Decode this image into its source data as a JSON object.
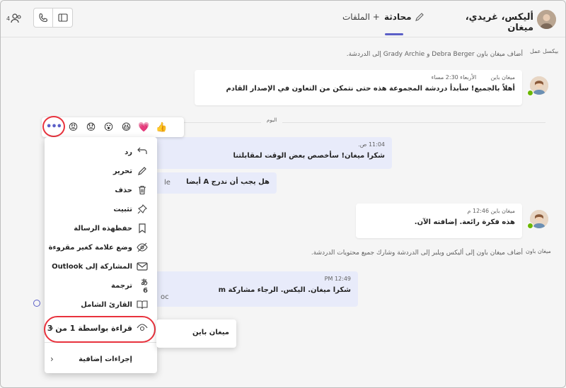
{
  "header": {
    "chat_title": "أليكس، غريدي، ميغان",
    "people_count": "4",
    "tabs": [
      {
        "label": "الملفات +"
      },
      {
        "label": "محادثة"
      }
    ]
  },
  "system_messages": [
    {
      "icon": "ﺑﻴﻜﺴﻞ ﻋﻤﻞ",
      "text": "أضاف ميغان باون Debra Berger و Grady Archie إلى الدردشة."
    },
    {
      "icon": "ﻣﻴﻐﺎﻥ ﺑﺎﻭﻥ",
      "text": "أضاف ميغان باون إلى أليكس ويلبر إلى الدردشة وشارك جميع محتويات الدردشة."
    }
  ],
  "day_divider": "اليوم",
  "messages": [
    {
      "sender": "ميغان باين",
      "time": "الأربعاء 2:30 مساء",
      "text": "أهلاً بالجميع! سأبدأ دردشة المجموعة هذه حتى نتمكن من التعاون في الإصدار القادم"
    },
    {
      "time": "11:04 ص.",
      "text": "شكرا ميغان! سأخصص بعض الوقت لمقابلتنا"
    },
    {
      "partial_left": "le",
      "text": "هل يجب أن ندرج A أيضا"
    },
    {
      "sender": "ميغان باين",
      "time": "12:46 م",
      "text": "هذه فكرة رائعة. إضافته الآن."
    },
    {
      "time": "12:49 PM",
      "partial_left": "oc",
      "text": "شكرا ميغان. اليكس. الرجاء مشاركة m"
    }
  ],
  "reactions": [
    "👍",
    "💗",
    "😆",
    "😮",
    "😟",
    "😡"
  ],
  "more_options_label": "•••",
  "menu": {
    "items": [
      {
        "label": "رد",
        "icon": "reply-icon"
      },
      {
        "label": "تحرير",
        "icon": "edit-icon"
      },
      {
        "label": "حذف",
        "icon": "delete-icon"
      },
      {
        "label": "تثبيت",
        "icon": "pin-icon"
      },
      {
        "label": "حفظهذه الرسالة",
        "icon": "bookmark-icon"
      },
      {
        "label": "وضع علامة كغير مقروءة",
        "icon": "mark-unread-icon"
      },
      {
        "label": "المشاركة إلى Outlook",
        "icon": "mail-icon"
      },
      {
        "label": "ترجمة",
        "icon": "translate-icon"
      },
      {
        "label": "القارئ الشامل",
        "icon": "immersive-reader-icon"
      },
      {
        "label": "قراءة بواسطة 1 من 3",
        "icon": "eye-icon"
      },
      {
        "label": "إجراءات إضافية",
        "icon": "more-actions-icon"
      }
    ]
  },
  "submenu": {
    "reader": "ميغان باين"
  },
  "colors": {
    "accent": "#5b5fc7",
    "highlight": "#e8323d",
    "presence": "#6bb700"
  }
}
